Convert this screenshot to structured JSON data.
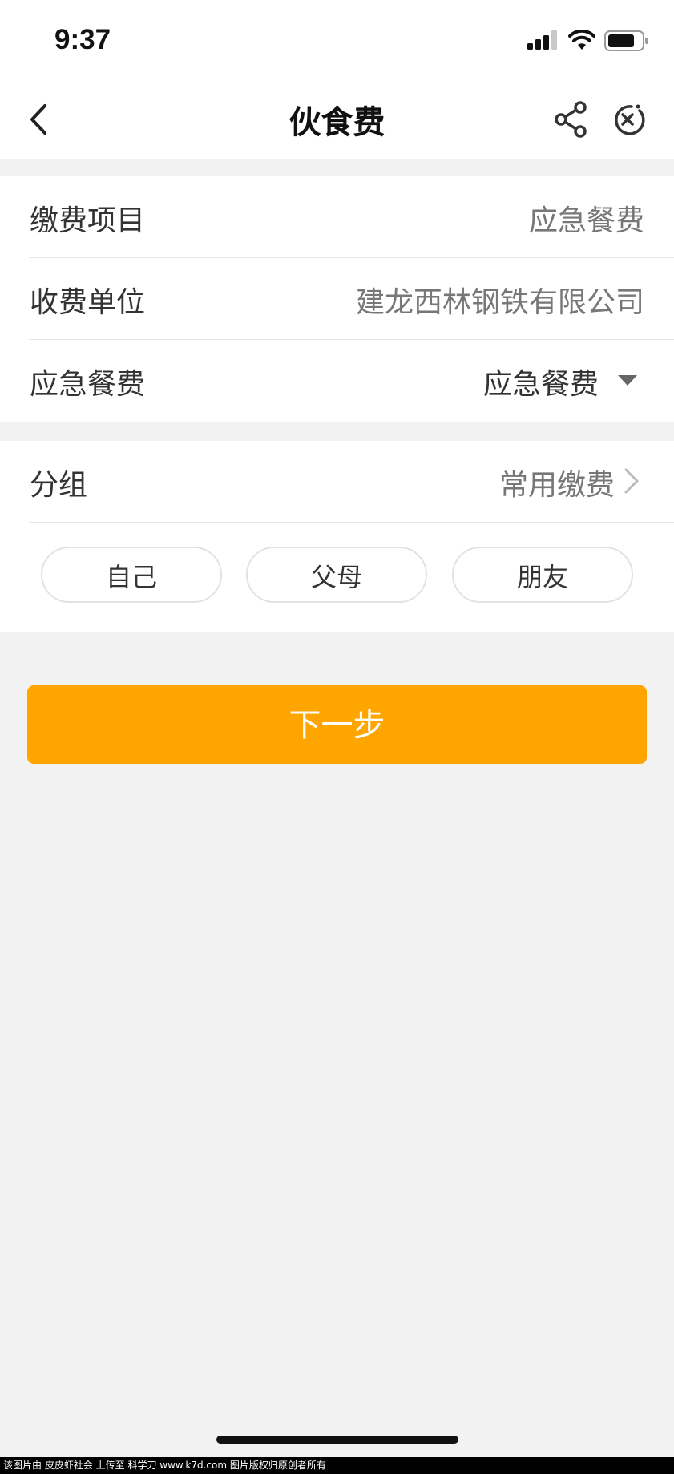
{
  "status_bar": {
    "time": "9:37"
  },
  "nav": {
    "title": "伙食费"
  },
  "info_rows": [
    {
      "label": "缴费项目",
      "value": "应急餐费"
    },
    {
      "label": "收费单位",
      "value": "建龙西林钢铁有限公司"
    },
    {
      "label": "应急餐费",
      "value": "应急餐费"
    }
  ],
  "group": {
    "label": "分组",
    "value": "常用缴费",
    "chips": [
      "自己",
      "父母",
      "朋友"
    ]
  },
  "next_button": {
    "label": "下一步"
  },
  "footer_text": "该图片由 皮皮虾社会 上传至 科学刀 www.k7d.com 图片版权归原创者所有",
  "colors": {
    "accent": "#ffa500",
    "background": "#f2f2f2"
  }
}
